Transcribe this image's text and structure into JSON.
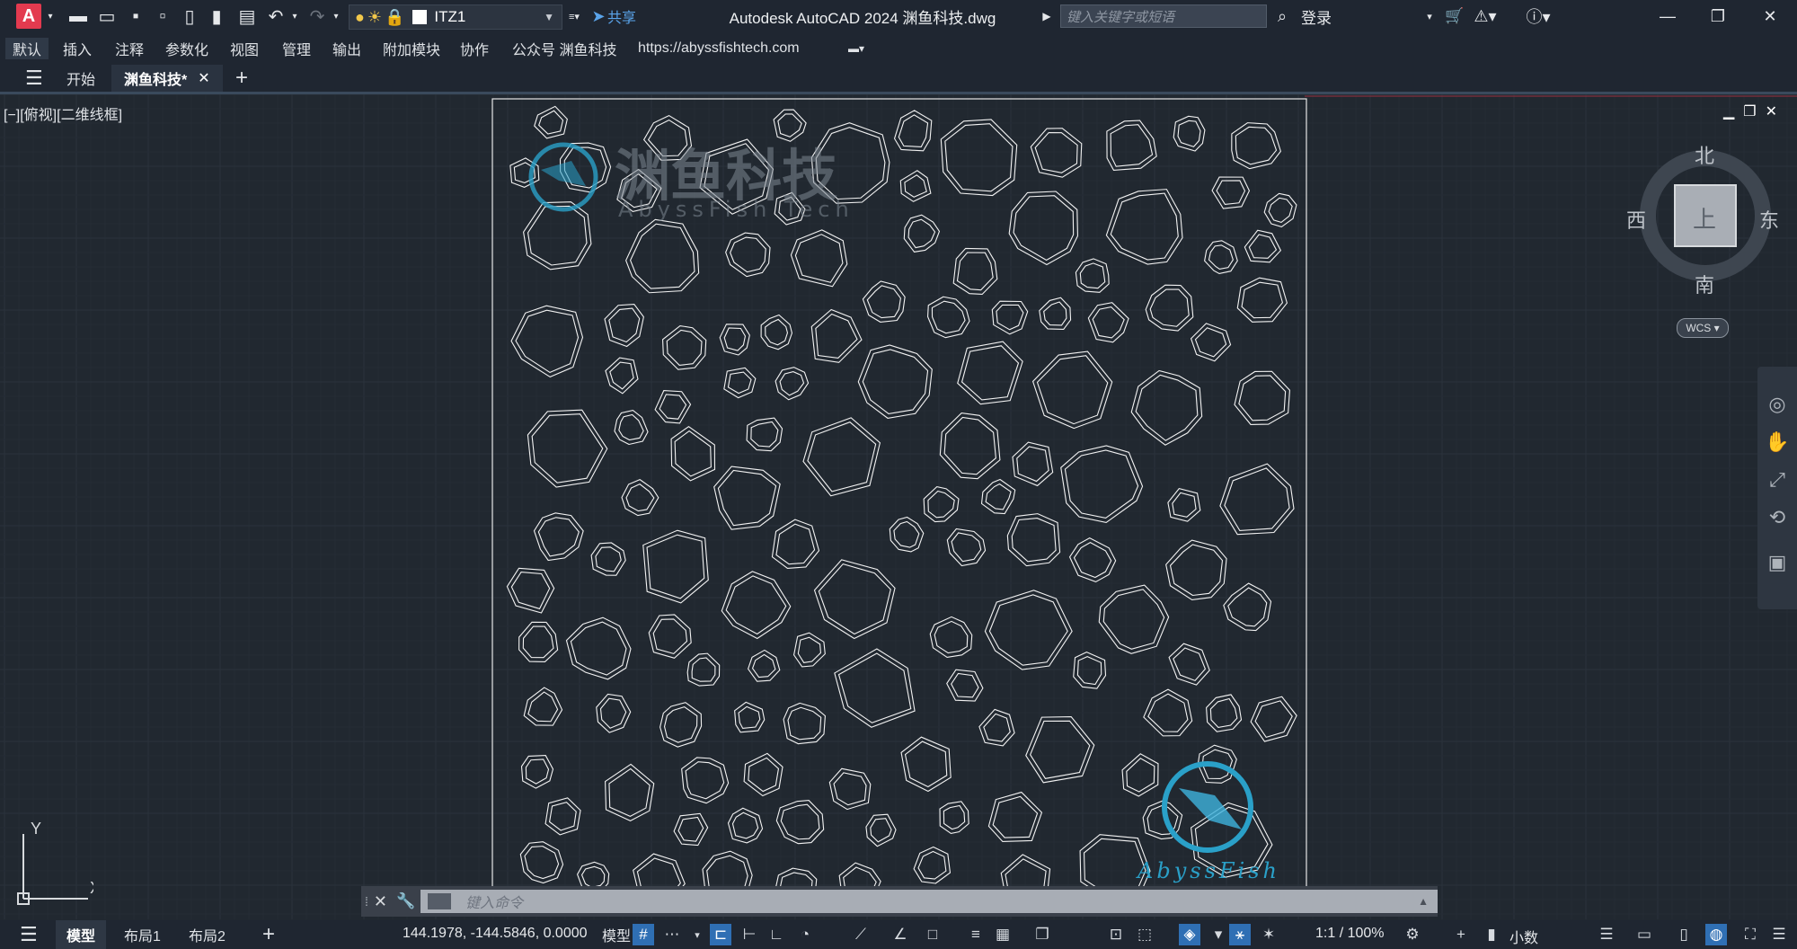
{
  "titlebar": {
    "app_logo": "A",
    "layer_name": "ITZ1",
    "share_label": "共享",
    "title": "Autodesk AutoCAD 2024    渊鱼科技.dwg",
    "search_placeholder": "键入关键字或短语",
    "login_label": "登录",
    "quick_access_icons": [
      "new-icon",
      "open-icon",
      "save-icon",
      "save-as-icon",
      "open-web-icon",
      "save-web-icon",
      "plot-icon",
      "undo-icon",
      "redo-icon"
    ],
    "window_icons": [
      "minimize-icon",
      "restore-icon",
      "close-icon"
    ]
  },
  "menu": {
    "items": [
      "默认",
      "插入",
      "注释",
      "参数化",
      "视图",
      "管理",
      "输出",
      "附加模块",
      "协作",
      "公众号 渊鱼科技",
      "https://abyssfishtech.com"
    ],
    "active": "默认"
  },
  "tabs": {
    "start_label": "开始",
    "file_label": "渊鱼科技*",
    "close_glyph": "✕",
    "add_glyph": "+"
  },
  "viewport": {
    "view_label": "[−][俯视][二维线框]",
    "compass": {
      "north": "北",
      "south": "南",
      "west": "西",
      "east": "东",
      "top": "上"
    },
    "wcs_label": "WCS ▾",
    "ucs_x": "X",
    "ucs_y": "Y",
    "watermark_cn": "渊鱼科技",
    "watermark_en": "AbyssFish Tech",
    "watermark_small": "AbyssFish"
  },
  "commandline": {
    "placeholder": "键入命令"
  },
  "statusbar": {
    "model_tab": "模型",
    "layout1": "布局1",
    "layout2": "布局2",
    "coords": "144.1978, -144.5846, 0.0000",
    "model_label": "模型",
    "scale": "1:1 / 100%",
    "units": "小数"
  },
  "colors": {
    "background": "#212830",
    "chrome": "#1f2631",
    "accent_red": "#e33a4f",
    "share_blue": "#5aa4ea",
    "status_active": "#2f6fb4",
    "linework": "#ffffff",
    "watermark": "#2aa0c8"
  }
}
